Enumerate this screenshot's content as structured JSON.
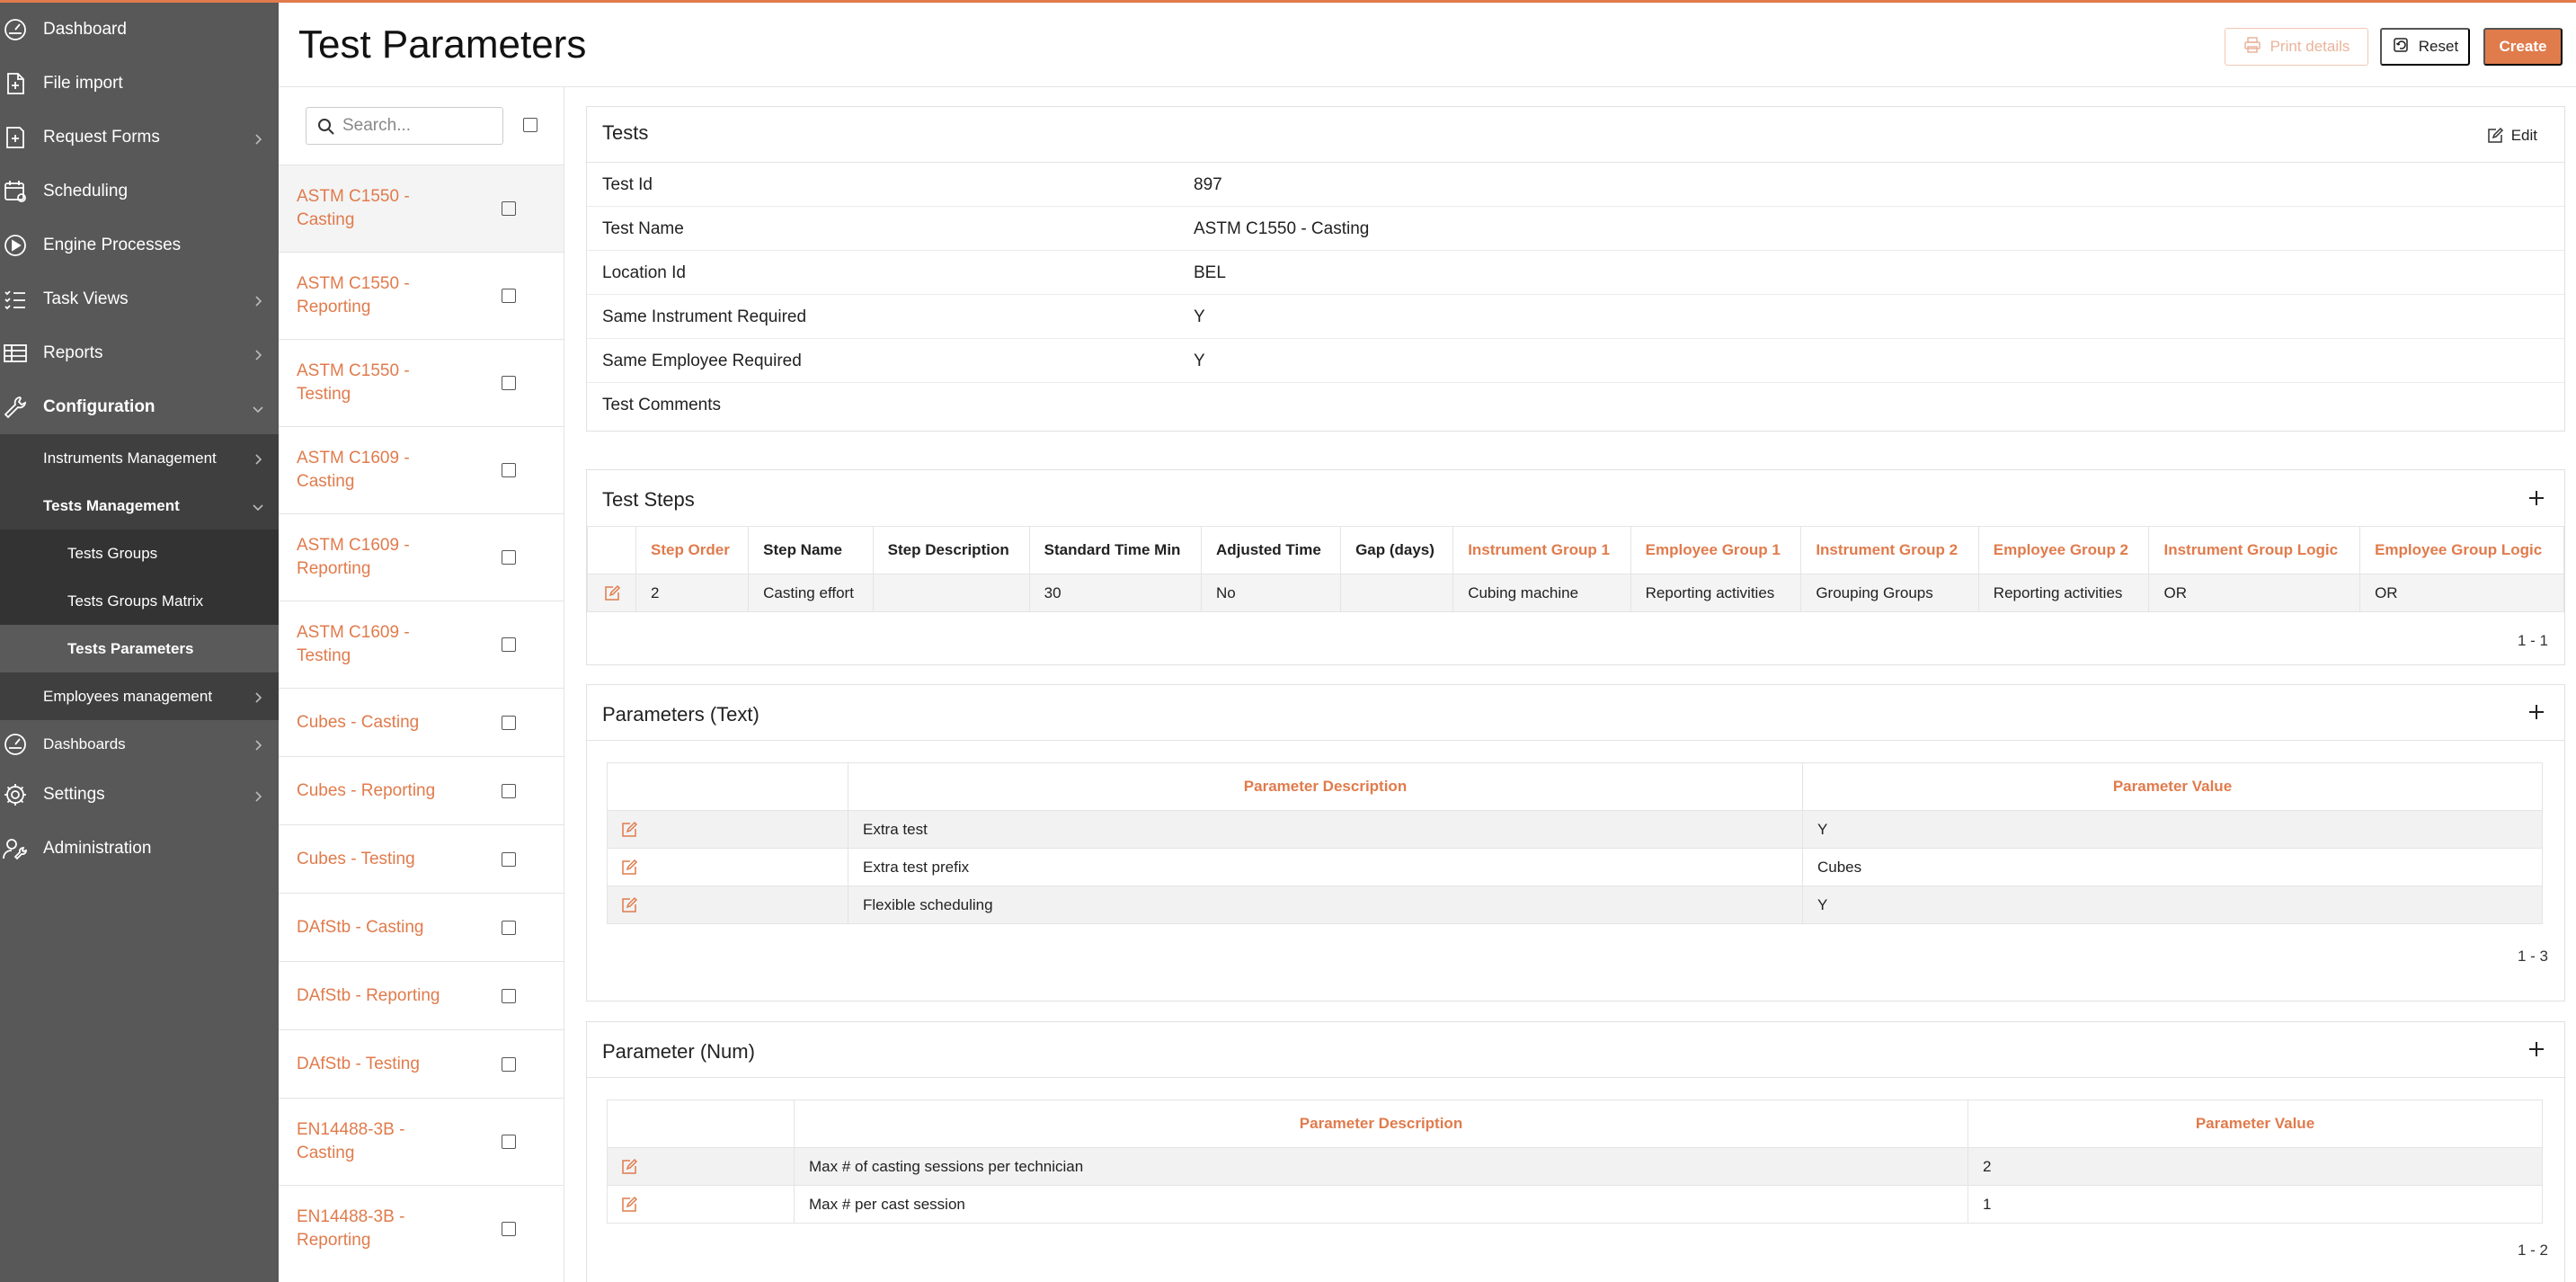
{
  "sidebar": {
    "items": [
      {
        "label": "Dashboard",
        "icon": "dashboard-gauge-icon"
      },
      {
        "label": "File import",
        "icon": "file-import-icon"
      },
      {
        "label": "Request Forms",
        "icon": "request-forms-icon"
      },
      {
        "label": "Scheduling",
        "icon": "scheduling-calendar-icon"
      },
      {
        "label": "Engine Processes",
        "icon": "engine-play-icon"
      },
      {
        "label": "Task Views",
        "icon": "task-list-icon"
      },
      {
        "label": "Reports",
        "icon": "reports-table-icon"
      },
      {
        "label": "Configuration",
        "icon": "configuration-wrench-icon"
      },
      {
        "label": "Dashboards",
        "icon": "dashboards-gauge-icon"
      },
      {
        "label": "Settings",
        "icon": "settings-gear-icon"
      },
      {
        "label": "Administration",
        "icon": "administration-user-wrench-icon"
      }
    ],
    "config_sub": [
      {
        "label": "Instruments Management"
      },
      {
        "label": "Tests Management"
      },
      {
        "label": "Employees management"
      }
    ],
    "tests_sub": [
      {
        "label": "Tests Groups"
      },
      {
        "label": "Tests Groups Matrix"
      },
      {
        "label": "Tests Parameters"
      }
    ]
  },
  "header": {
    "title": "Test Parameters",
    "print_label": "Print details",
    "reset_label": "Reset",
    "create_label": "Create"
  },
  "list": {
    "search_placeholder": "Search...",
    "items": [
      "ASTM C1550 - Casting",
      "ASTM C1550 - Reporting",
      "ASTM C1550 - Testing",
      "ASTM C1609 - Casting",
      "ASTM C1609 - Reporting",
      "ASTM C1609 - Testing",
      "Cubes - Casting",
      "Cubes - Reporting",
      "Cubes - Testing",
      "DAfStb - Casting",
      "DAfStb - Reporting",
      "DAfStb - Testing",
      "EN14488-3B - Casting",
      "EN14488-3B - Reporting"
    ]
  },
  "tests": {
    "title": "Tests",
    "edit_label": "Edit",
    "fields": [
      {
        "k": "Test Id",
        "v": "897"
      },
      {
        "k": "Test Name",
        "v": "ASTM C1550 - Casting"
      },
      {
        "k": "Location Id",
        "v": "BEL"
      },
      {
        "k": "Same Instrument Required",
        "v": "Y"
      },
      {
        "k": "Same Employee Required",
        "v": "Y"
      },
      {
        "k": "Test Comments",
        "v": ""
      }
    ]
  },
  "steps": {
    "title": "Test Steps",
    "headers": [
      "Step Order",
      "Step Name",
      "Step Description",
      "Standard Time Min",
      "Adjusted Time",
      "Gap (days)",
      "Instrument Group 1",
      "Employee Group 1",
      "Instrument Group 2",
      "Employee Group 2",
      "Instrument Group Logic",
      "Employee Group Logic"
    ],
    "rows": [
      [
        "2",
        "Casting effort",
        "",
        "30",
        "No",
        "",
        "Cubing machine",
        "Reporting activities",
        "Grouping Groups",
        "Reporting activities",
        "OR",
        "OR"
      ]
    ],
    "pager": "1 - 1"
  },
  "params_text": {
    "title": "Parameters (Text)",
    "headers": [
      "Parameter Description",
      "Parameter Value"
    ],
    "rows": [
      [
        "Extra test",
        "Y"
      ],
      [
        "Extra test prefix",
        "Cubes"
      ],
      [
        "Flexible scheduling",
        "Y"
      ]
    ],
    "pager": "1 - 3"
  },
  "params_num": {
    "title": "Parameter (Num)",
    "headers": [
      "Parameter Description",
      "Parameter Value"
    ],
    "rows": [
      [
        "Max # of casting sessions per technician",
        "2"
      ],
      [
        "Max # per cast session",
        "1"
      ]
    ],
    "pager": "1 - 2"
  }
}
